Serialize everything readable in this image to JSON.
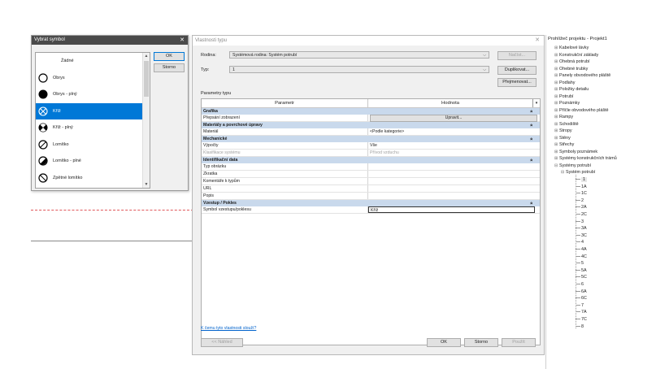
{
  "symbol_dialog": {
    "title": "Vybrat symbol",
    "items": [
      {
        "label": "Žádné",
        "icon": "none"
      },
      {
        "label": "Obrys",
        "icon": "circle-outline-icon"
      },
      {
        "label": "Obrys - plný",
        "icon": "circle-filled-icon"
      },
      {
        "label": "Kříž",
        "icon": "circle-cross-icon",
        "selected": true
      },
      {
        "label": "Kříž - plný",
        "icon": "circle-cross-filled-icon"
      },
      {
        "label": "Lomítko",
        "icon": "circle-slash-icon"
      },
      {
        "label": "Lomítko - plné",
        "icon": "circle-slash-filled-icon"
      },
      {
        "label": "Zpětné lomítko",
        "icon": "circle-backslash-icon"
      }
    ],
    "ok": "OK",
    "cancel": "Storno",
    "selected_color": "#0078d7"
  },
  "props": {
    "title": "Vlastnosti typu",
    "family_label": "Rodina:",
    "family_value": "Systémová rodina: Systém potrubí",
    "type_label": "Typ:",
    "type_value": "1",
    "load": "Načíst...",
    "duplicate": "Duplikovat...",
    "rename": "Přejmenovat...",
    "params_label": "Parametry typu",
    "col_param": "Parametr",
    "col_value": "Hodnota",
    "groups": [
      {
        "name": "Grafika",
        "rows": [
          {
            "p": "Přepsání zobrazení",
            "v": "Upravit...",
            "button": true
          }
        ]
      },
      {
        "name": "Materiály a povrchové úpravy",
        "rows": [
          {
            "p": "Materiál",
            "v": "<Podle kategorie>"
          }
        ]
      },
      {
        "name": "Mechanické",
        "rows": [
          {
            "p": "Výpočty",
            "v": "Vše"
          },
          {
            "p": "Klasifikace systému",
            "v": "Přívod vzduchu",
            "dim": true
          }
        ]
      },
      {
        "name": "Identifikační data",
        "rows": [
          {
            "p": "Typ obrázku",
            "v": ""
          },
          {
            "p": "Zkratka",
            "v": ""
          },
          {
            "p": "Komentáře k typům",
            "v": ""
          },
          {
            "p": "URL",
            "v": ""
          },
          {
            "p": "Popis",
            "v": ""
          }
        ]
      },
      {
        "name": "Vzestup / Pokles",
        "rows": [
          {
            "p": "Symbol vzestupu/poklesu",
            "v": "Kříž",
            "boxed": true
          }
        ]
      }
    ],
    "help_link": "K čemu tyto vlastnosti slouží?",
    "preview": "<< Náhled",
    "ok": "OK",
    "cancel": "Storno",
    "apply": "Použít",
    "group_color": "#c9d9ec"
  },
  "browser": {
    "title": "Prohlížeč projektu - Projekt1",
    "items": [
      "Kabelové lávky",
      "Konstrukční základy",
      "Ohebná potrubí",
      "Ohebné trubky",
      "Panely obvodového pláště",
      "Podlahy",
      "Položky detailu",
      "Potrubí",
      "Poznámky",
      "Příčle obvodového pláště",
      "Rampy",
      "Schodiště",
      "Stropy",
      "Stěny",
      "Střechy",
      "Symboly poznámek",
      "Systémy konstrukčních trámů",
      "Systémy potrubí"
    ],
    "sub_parent": "Systém potrubí",
    "leaves": [
      "1",
      "1A",
      "1C",
      "2",
      "2A",
      "2C",
      "3",
      "3A",
      "3C",
      "4",
      "4A",
      "4C",
      "5",
      "5A",
      "5C",
      "6",
      "6A",
      "6C",
      "7",
      "7A",
      "7C",
      "8"
    ]
  }
}
